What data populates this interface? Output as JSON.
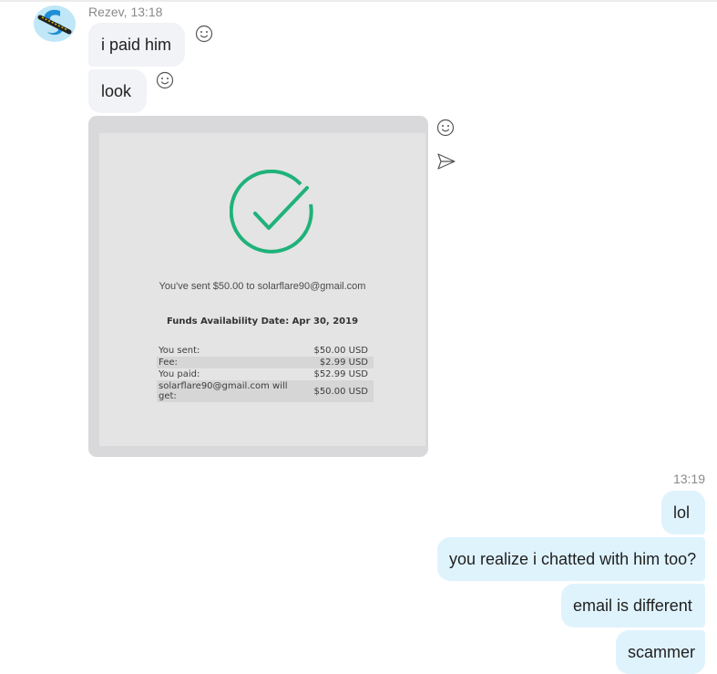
{
  "incoming": {
    "sender": "Rezev",
    "time": "13:18",
    "messages": [
      "i paid him",
      "look"
    ]
  },
  "receipt": {
    "sent_text": "You've sent $50.00 to solarflare90@gmail.com",
    "funds_text": "Funds Availability Date: Apr 30, 2019",
    "rows": [
      {
        "label": "You sent:",
        "value": "$50.00 USD"
      },
      {
        "label": "Fee:",
        "value": "$2.99 USD"
      },
      {
        "label": "You paid:",
        "value": "$52.99 USD"
      },
      {
        "label": "solarflare90@gmail.com will get:",
        "value": "$50.00 USD"
      }
    ],
    "accent_color": "#1fb27a"
  },
  "outgoing": {
    "time": "13:19",
    "messages": [
      "lol",
      "you realize i chatted with him too?",
      "email is different",
      "scammer"
    ]
  },
  "icons": {
    "reaction": "smiley-face-icon",
    "forward": "forward-arrow-icon",
    "avatar": "skype-logo-avatar"
  },
  "colors": {
    "incoming_bubble": "#f1f3f6",
    "outgoing_bubble": "#dff3fd"
  }
}
